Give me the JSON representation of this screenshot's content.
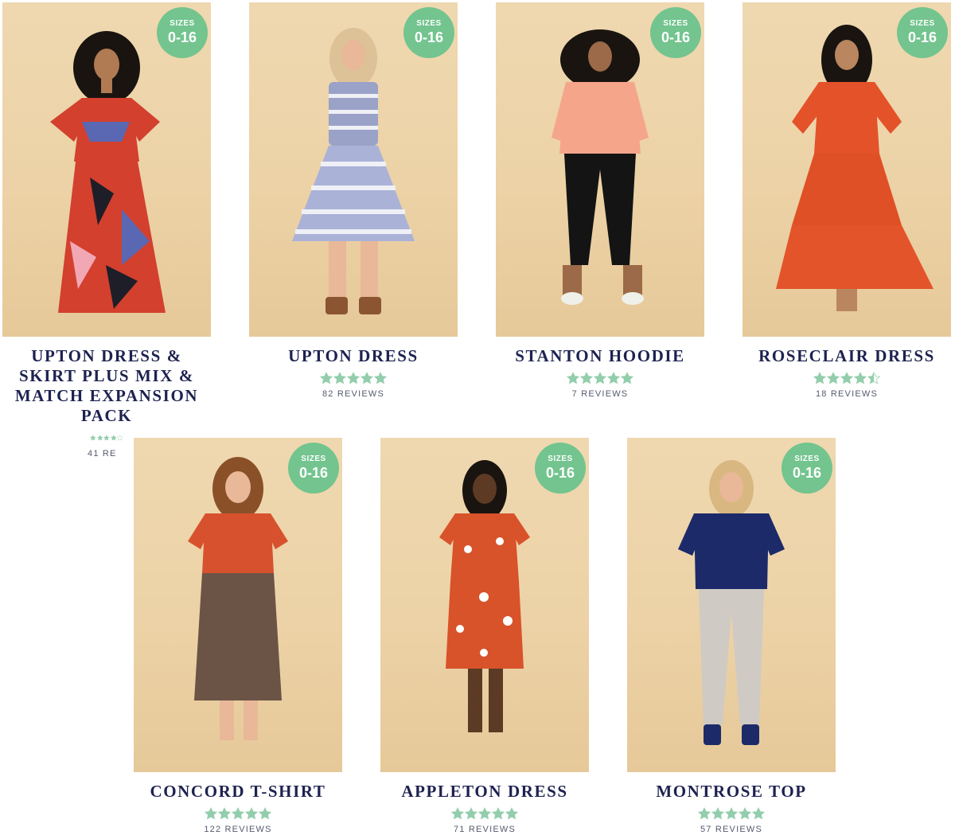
{
  "colors": {
    "navy": "#1d2250",
    "badge": "#73c48e",
    "star": "#93ceac"
  },
  "products": [
    {
      "title": "UPTON DRESS & SKIRT PLUS MIX & MATCH EXPANSION PACK",
      "badge_label": "SIZES",
      "badge_value": "0-16",
      "rating": 4,
      "reviews": "41 RE"
    },
    {
      "title": "UPTON DRESS",
      "badge_label": "SIZES",
      "badge_value": "0-16",
      "rating": 5,
      "reviews": "82 REVIEWS"
    },
    {
      "title": "STANTON HOODIE",
      "badge_label": "SIZES",
      "badge_value": "0-16",
      "rating": 5,
      "reviews": "7 REVIEWS"
    },
    {
      "title": "ROSECLAIR DRESS",
      "badge_label": "SIZES",
      "badge_value": "0-16",
      "rating": 4.5,
      "reviews": "18 REVIEWS"
    },
    {
      "title": "CONCORD T-SHIRT",
      "badge_label": "SIZES",
      "badge_value": "0-16",
      "rating": 5,
      "reviews": "122 REVIEWS"
    },
    {
      "title": "APPLETON DRESS",
      "badge_label": "SIZES",
      "badge_value": "0-16",
      "rating": 5,
      "reviews": "71 REVIEWS"
    },
    {
      "title": "MONTROSE TOP",
      "badge_label": "SIZES",
      "badge_value": "0-16",
      "rating": 5,
      "reviews": "57 REVIEWS"
    }
  ]
}
